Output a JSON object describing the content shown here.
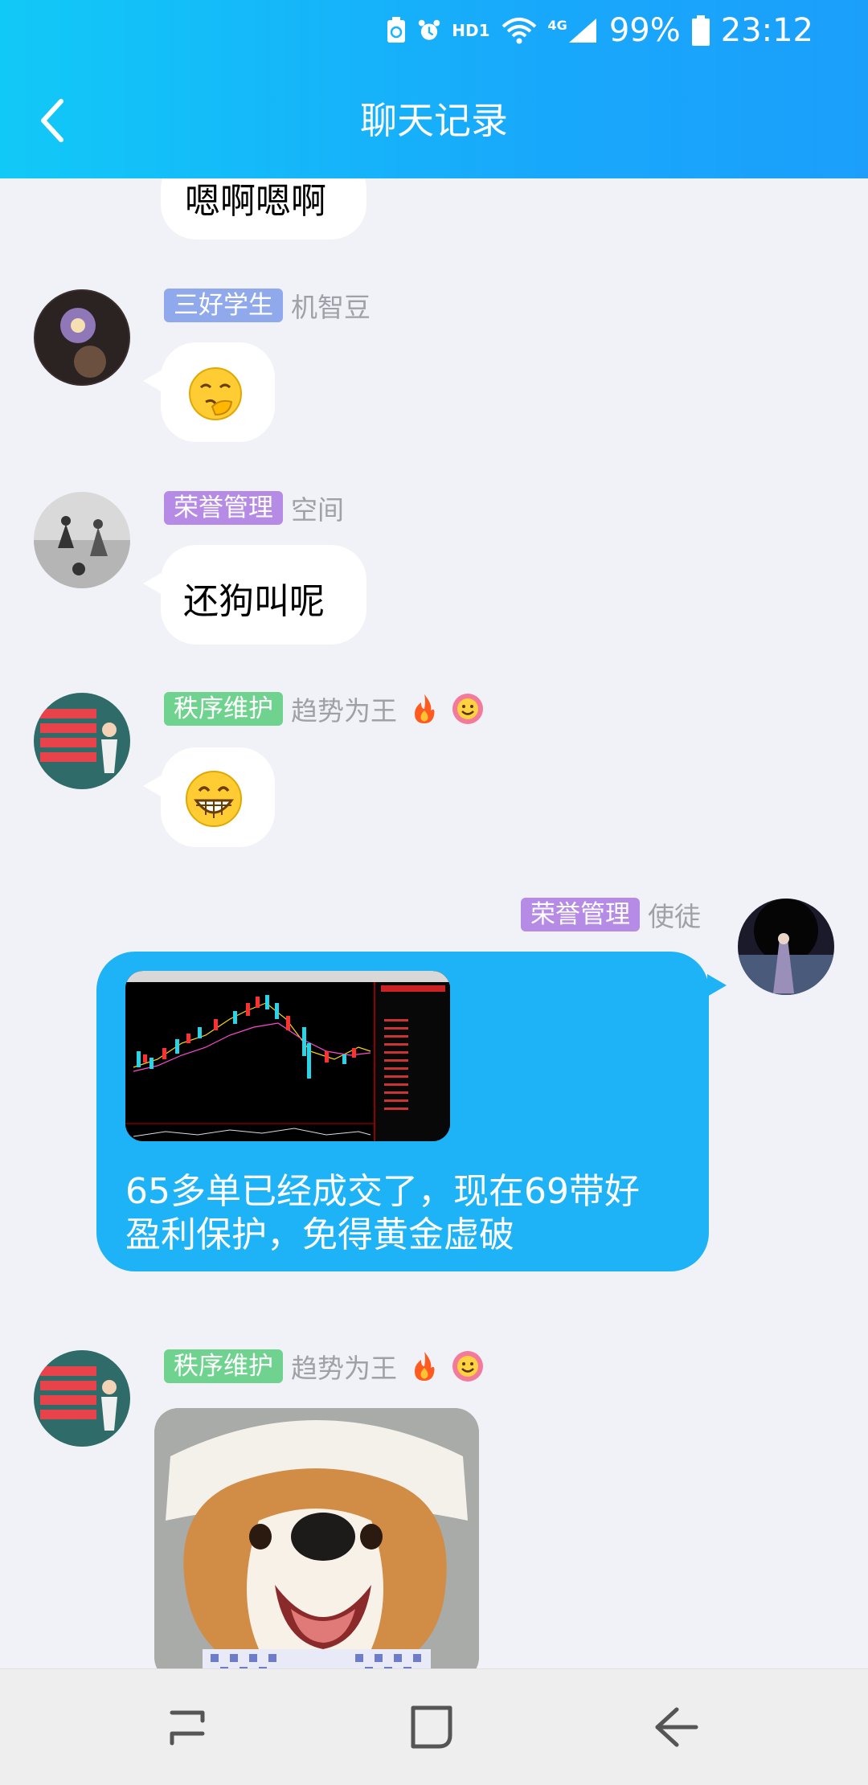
{
  "status_bar": {
    "hd_label": "HD1",
    "network_label": "4G",
    "battery": "99%",
    "time": "23:12"
  },
  "header": {
    "title": "聊天记录"
  },
  "messages": [
    {
      "text": "嗯啊嗯啊"
    },
    {
      "badge": "三好学生",
      "badge_color": "#8fa9ec",
      "nick": "机智豆",
      "emoji": "smirk-hand-emoji"
    },
    {
      "badge": "荣誉管理",
      "badge_color": "#b58be6",
      "nick": "空间",
      "text": "还狗叫呢"
    },
    {
      "badge": "秩序维护",
      "badge_color": "#6fd28e",
      "nick": "趋势为王",
      "emoji": "grin-emoji"
    },
    {
      "badge": "荣誉管理",
      "badge_color": "#b58be6",
      "nick": "使徒",
      "image_name": "stock-chart-image",
      "text_line1": "65多单已经成交了，现在69带好",
      "text_line2": "盈利保护，免得黄金虚破"
    },
    {
      "badge": "秩序维护",
      "badge_color": "#6fd28e",
      "nick": "趋势为王",
      "image_name": "corgi-photo"
    }
  ],
  "colors": {
    "header_start": "#11c9f7",
    "header_end": "#1b9ffb",
    "my_bubble": "#1db3f6",
    "background": "#f1f2f7"
  }
}
